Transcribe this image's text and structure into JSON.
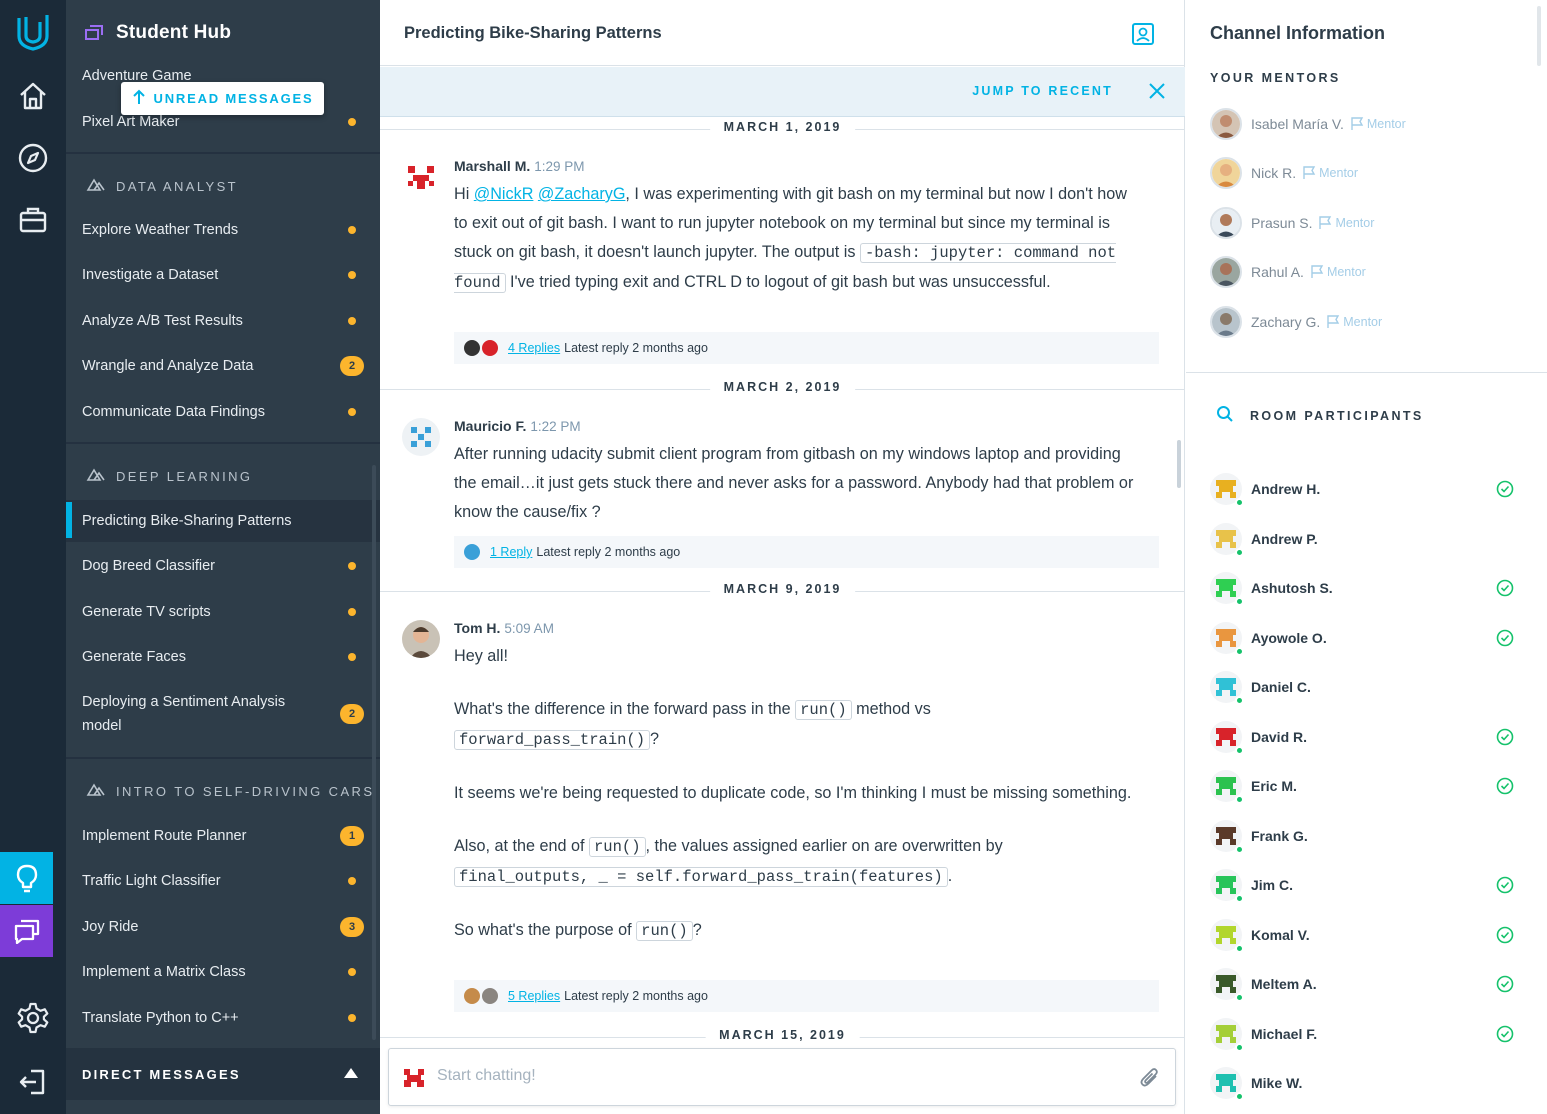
{
  "app": {
    "name": "Student Hub"
  },
  "rail": {
    "items": [
      "logo-icon",
      "home-icon",
      "explore-compass-icon",
      "briefcase-icon",
      "knowledge-lightbulb-icon",
      "student-hub-icon",
      "settings-gear-icon",
      "logout-icon"
    ]
  },
  "sidebar": {
    "unread_label": "UNREAD MESSAGES",
    "top_items": [
      {
        "label": "Adventure Game"
      },
      {
        "label": "Pixel Art Maker"
      }
    ],
    "sections": [
      {
        "title": "DATA ANALYST",
        "items": [
          {
            "label": "Explore Weather Trends",
            "badge": ""
          },
          {
            "label": "Investigate a Dataset",
            "badge": ""
          },
          {
            "label": "Analyze A/B Test Results",
            "badge": ""
          },
          {
            "label": "Wrangle and Analyze Data",
            "badge": "2"
          },
          {
            "label": "Communicate Data Findings",
            "badge": ""
          }
        ]
      },
      {
        "title": "DEEP LEARNING",
        "items": [
          {
            "label": "Predicting Bike-Sharing Patterns",
            "badge": ""
          },
          {
            "label": "Dog Breed Classifier",
            "badge": ""
          },
          {
            "label": "Generate TV scripts",
            "badge": ""
          },
          {
            "label": "Generate Faces",
            "badge": ""
          },
          {
            "label": "Deploying a Sentiment Analysis model",
            "badge": "2"
          }
        ]
      },
      {
        "title": "INTRO TO SELF-DRIVING CARS",
        "items": [
          {
            "label": "Implement Route Planner",
            "badge": "1"
          },
          {
            "label": "Traffic Light Classifier",
            "badge": ""
          },
          {
            "label": "Joy Ride",
            "badge": "3"
          },
          {
            "label": "Implement a Matrix Class",
            "badge": ""
          },
          {
            "label": "Translate Python to C++",
            "badge": ""
          }
        ]
      }
    ],
    "direct_messages_label": "DIRECT MESSAGES"
  },
  "chat": {
    "title": "Predicting Bike-Sharing Patterns",
    "jump_label": "JUMP TO RECENT",
    "dates": [
      "MARCH 1, 2019",
      "MARCH 2, 2019",
      "MARCH 9, 2019",
      "MARCH 15, 2019"
    ],
    "messages": [
      {
        "author": "Marshall M.",
        "time": "1:29 PM",
        "hi": "Hi",
        "mention1": "@NickR",
        "mention2": "@ZacharyG",
        "text1": ", I was experimenting with git bash on my terminal but now I don't how to exit out of git bash. I want to run jupyter notebook on my terminal but since my terminal is stuck on git bash, it doesn't launch jupyter. The output is",
        "code1": "-bash: jupyter: command not found",
        "text2": "I've tried typing exit and CTRL D to logout of git bash but was unsuccessful.",
        "replies": "4 Replies",
        "latest": "Latest reply 2 months ago"
      },
      {
        "author": "Mauricio F.",
        "time": "1:22 PM",
        "text": "After running udacity submit client program from gitbash on my windows laptop and providing the email…it just gets stuck there and never asks for a password. Anybody had that problem or know the cause/fix ?",
        "replies": "1 Reply",
        "latest": "Latest reply 2 months ago"
      },
      {
        "author": "Tom H.",
        "time": "5:09 AM",
        "p1": "Hey all!",
        "p2a": "What's the difference in the forward pass in the",
        "p2code1": "run()",
        "p2b": "method vs",
        "p2code2": "forward_pass_train()",
        "p2c": "?",
        "p3": "It seems we're being requested to duplicate code, so I'm thinking I must be missing something.",
        "p4a": "Also, at the end of",
        "p4code1": "run()",
        "p4b": ", the values assigned earlier on are overwritten by",
        "p4code2": "final_outputs, _ = self.forward_pass_train(features)",
        "p4c": ".",
        "p5a": "So what's the purpose of",
        "p5code": "run()",
        "p5b": "?",
        "replies": "5 Replies",
        "latest": "Latest reply 2 months ago"
      }
    ],
    "composer_placeholder": "Start chatting!"
  },
  "info": {
    "title": "Channel Information",
    "mentors_heading": "YOUR MENTORS",
    "mentor_role": "Mentor",
    "mentors": [
      "Isabel María V.",
      "Nick R.",
      "Prasun S.",
      "Rahul A.",
      "Zachary G."
    ],
    "participants_heading": "ROOM PARTICIPANTS",
    "participants": [
      {
        "name": "Andrew H.",
        "verified": true,
        "color": "#e8b020"
      },
      {
        "name": "Andrew P.",
        "verified": false,
        "color": "#e8c24a"
      },
      {
        "name": "Ashutosh S.",
        "verified": true,
        "color": "#2fcf52"
      },
      {
        "name": "Ayowole O.",
        "verified": true,
        "color": "#e9963f"
      },
      {
        "name": "Daniel C.",
        "verified": false,
        "color": "#30c1d6"
      },
      {
        "name": "David R.",
        "verified": true,
        "color": "#d8232a"
      },
      {
        "name": "Eric M.",
        "verified": true,
        "color": "#2bc24f"
      },
      {
        "name": "Frank G.",
        "verified": false,
        "color": "#5a3a2a"
      },
      {
        "name": "Jim C.",
        "verified": true,
        "color": "#27c45a"
      },
      {
        "name": "Komal V.",
        "verified": true,
        "color": "#b2d62c"
      },
      {
        "name": "Meltem A.",
        "verified": true,
        "color": "#3a5a2a"
      },
      {
        "name": "Michael F.",
        "verified": true,
        "color": "#a5cf38"
      },
      {
        "name": "Mike W.",
        "verified": false,
        "color": "#1ec0b0"
      }
    ]
  },
  "colors": {
    "accent": "#02b3e4",
    "badge": "#fcb52d",
    "rail": "#1b2a38",
    "sidebar": "#2e3d49",
    "online": "#15c26b"
  }
}
